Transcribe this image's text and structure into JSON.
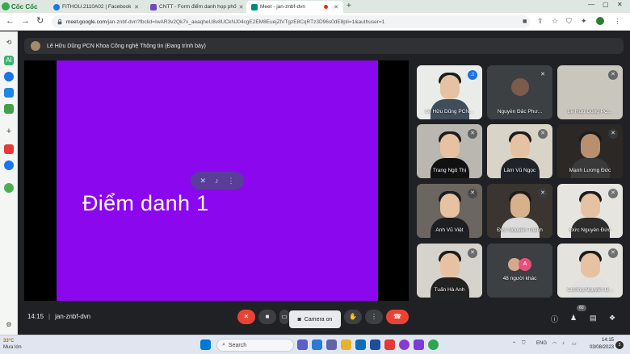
{
  "browser": {
    "brand": "Cốc Cốc",
    "tabs": [
      {
        "label": "FITHOU.2110A02 | Facebook",
        "favicon_color": "#1877f2",
        "active": false
      },
      {
        "label": "CNTT - Form điểm danh họp phố",
        "favicon_color": "#7248b9",
        "active": false
      },
      {
        "label": "Meet - jan-znbf-dvn",
        "favicon_color": "#00897b",
        "active": true
      }
    ],
    "new_tab": "+",
    "url_host": "meet.google.com",
    "url_path": "/jan-znbf-dvn?fbclid=IwAR3v2Qk7v_aeaqheU8v8UCkNJ04cgE2EM8EuejZlVTgzE8CqRTz3D96s0dE8pli=1&authuser=1"
  },
  "meet": {
    "presenter_text": "Lê Hữu Dũng PCN Khoa Công nghệ Thông tin (Đang trình bày)",
    "slide_title": "Điểm danh 1",
    "participants": [
      {
        "name": "Lê Hữu Dũng PCN...",
        "speaking": true
      },
      {
        "name": "Nguyễn Đắc Phư...",
        "speaking": false
      },
      {
        "name": "Lê Hữu Dũng PC...",
        "speaking": false
      },
      {
        "name": "Trang Ngô Thị",
        "speaking": false
      },
      {
        "name": "Lâm Vũ Ngọc",
        "speaking": false
      },
      {
        "name": "Mạnh Lương Đức",
        "speaking": false
      },
      {
        "name": "Anh Vũ Việt",
        "speaking": false
      },
      {
        "name": "Đức Nguyễn Thanh",
        "speaking": false
      },
      {
        "name": "Đức Nguyễn Đức",
        "speaking": false
      },
      {
        "name": "Tuấn Hà Anh",
        "speaking": false
      },
      {
        "name": "48 người khác",
        "speaking": false
      },
      {
        "name": "Cường Nguyễn Đ...",
        "speaking": false
      }
    ],
    "others_avatars": [
      "",
      "A"
    ],
    "time": "14:15",
    "meeting_code": "jan-znbf-dvn",
    "camera_tooltip": "Camera on",
    "people_count": "60"
  },
  "taskbar": {
    "weather_temp": "33°C",
    "weather_desc": "Mưa lớn",
    "search_placeholder": "Search",
    "lang": "ENG",
    "clock_time": "14:15",
    "clock_date": "03/08/2023",
    "notifications": "3"
  }
}
